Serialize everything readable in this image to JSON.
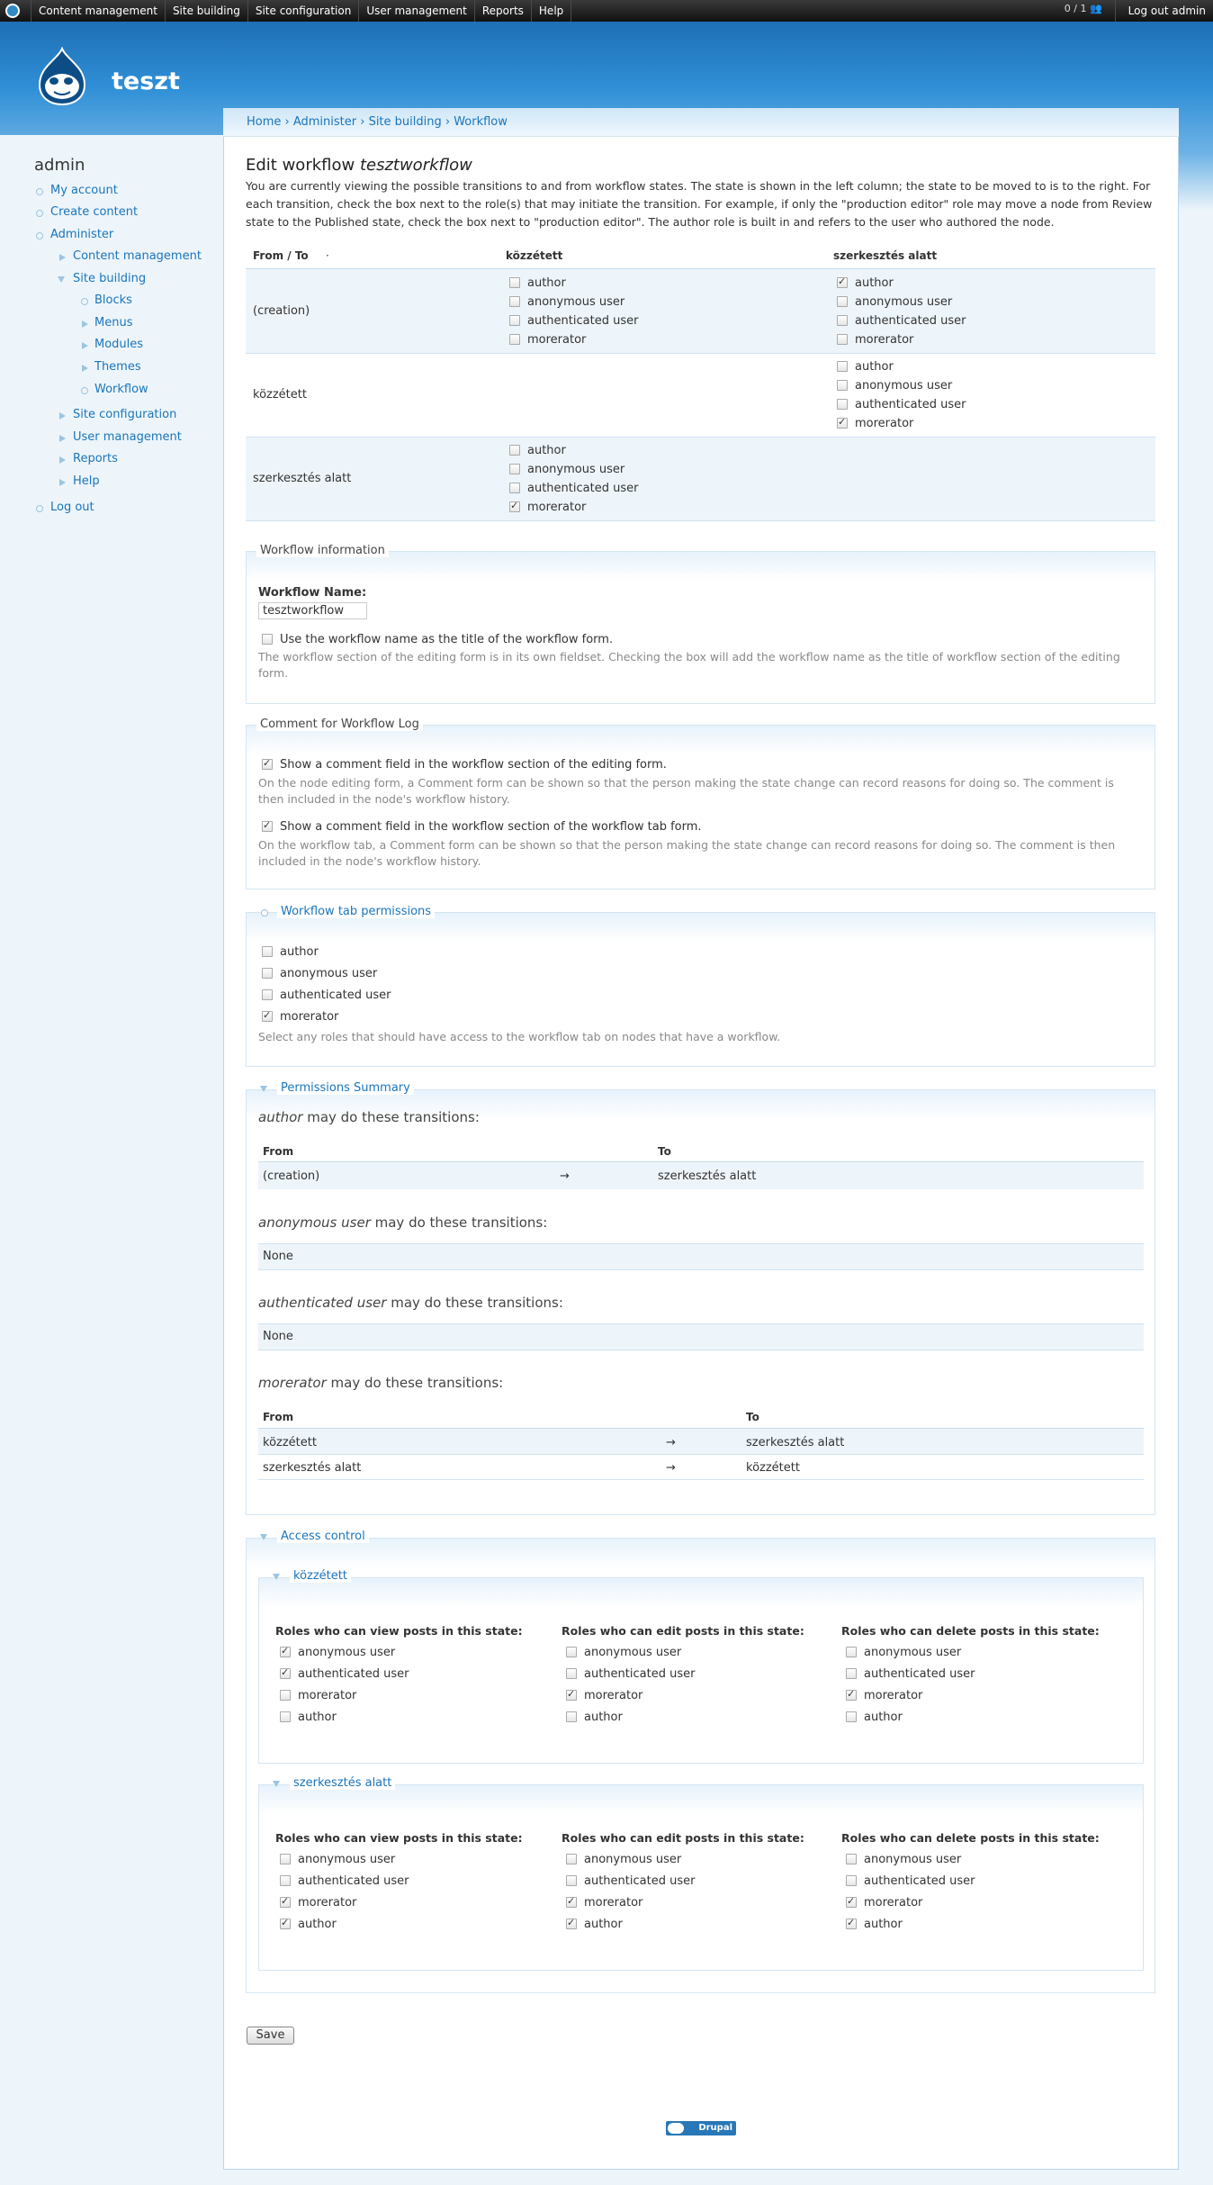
{
  "toolbar": {
    "items": [
      "Content management",
      "Site building",
      "Site configuration",
      "User management",
      "Reports",
      "Help"
    ],
    "counter": "0 / 1",
    "logout": "Log out admin"
  },
  "site": {
    "name": "teszt"
  },
  "breadcrumb": "Home › Administer › Site building › Workflow",
  "sidebar": {
    "title": "admin",
    "my_account": "My account",
    "create_content": "Create content",
    "administer": "Administer",
    "content_management": "Content management",
    "site_building": "Site building",
    "blocks": "Blocks",
    "menus": "Menus",
    "modules": "Modules",
    "themes": "Themes",
    "workflow": "Workflow",
    "site_configuration": "Site configuration",
    "user_management": "User management",
    "reports": "Reports",
    "help": "Help",
    "log_out": "Log out"
  },
  "page": {
    "title_prefix": "Edit workflow ",
    "title_name": "tesztworkflow",
    "intro": "You are currently viewing the possible transitions to and from workflow states. The state is shown in the left column; the state to be moved to is to the right. For each transition, check the box next to the role(s) that may initiate the transition. For example, if only the \"production editor\" role may move a node from Review state to the Published state, check the box next to \"production editor\". The author role is built in and refers to the user who authored the node."
  },
  "roles": {
    "author": "author",
    "anon": "anonymous user",
    "auth": "authenticated user",
    "morerator": "morerator"
  },
  "transitions": {
    "col_from": "From / To",
    "sort": "·",
    "col_pub": "közzétett",
    "col_draft": "szerkesztés alatt",
    "row_creation": "(creation)",
    "row_pub": "közzétett",
    "row_draft": "szerkesztés alatt"
  },
  "wf_info": {
    "legend": "Workflow information",
    "name_label": "Workflow Name:",
    "name_value": "tesztworkflow",
    "use_name_label": "Use the workflow name as the title of the workflow form.",
    "use_name_desc": "The workflow section of the editing form is in its own fieldset. Checking the box will add the workflow name as the title of workflow section of the editing form."
  },
  "comment": {
    "legend": "Comment for Workflow Log",
    "opt1": "Show a comment field in the workflow section of the editing form.",
    "desc1": "On the node editing form, a Comment form can be shown so that the person making the state change can record reasons for doing so. The comment is then included in the node's workflow history.",
    "opt2": "Show a comment field in the workflow section of the workflow tab form.",
    "desc2": "On the workflow tab, a Comment form can be shown so that the person making the state change can record reasons for doing so. The comment is then included in the node's workflow history."
  },
  "tab_perm": {
    "legend": "Workflow tab permissions",
    "desc": "Select any roles that should have access to the workflow tab on nodes that have a workflow."
  },
  "summary": {
    "legend": "Permissions Summary",
    "author": "author",
    "anon": "anonymous user",
    "auth": "authenticated user",
    "morerator": "morerator",
    "suffix": " may do these transitions:",
    "from": "From",
    "to": "To",
    "arrow": "→",
    "none": "None",
    "creation": "(creation)",
    "pub": "közzétett",
    "draft": "szerkesztés alatt"
  },
  "access": {
    "legend": "Access control",
    "pub": "közzétett",
    "draft": "szerkesztés alatt",
    "view": "Roles who can view posts in this state:",
    "edit": "Roles who can edit posts in this state:",
    "delete": "Roles who can delete posts in this state:"
  },
  "save": "Save",
  "footer_badge": "Drupal"
}
